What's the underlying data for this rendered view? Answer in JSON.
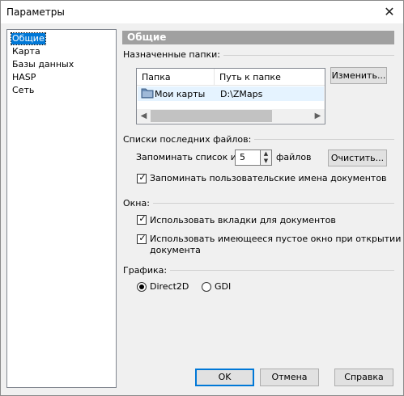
{
  "window": {
    "title": "Параметры",
    "close": "✕"
  },
  "nav": {
    "items": [
      "Общие",
      "Карта",
      "Базы данных",
      "HASP",
      "Сеть"
    ],
    "selected": 0
  },
  "section": {
    "title": "Общие"
  },
  "folders": {
    "label": "Назначенные папки:",
    "columns": [
      "Папка",
      "Путь к папке"
    ],
    "rows": [
      {
        "name": "Мои карты",
        "path": "D:\\ZMaps"
      }
    ],
    "change_button": "Изменить..."
  },
  "recent": {
    "label": "Списки последних файлов:",
    "remember_prefix": "Запоминать список из",
    "count": "5",
    "remember_suffix": "файлов",
    "clear_button": "Очистить...",
    "remember_names": {
      "label": "Запоминать пользовательские имена документов",
      "checked": true
    }
  },
  "windows": {
    "label": "Окна:",
    "use_tabs": {
      "label": "Использовать вкладки для документов",
      "checked": true
    },
    "reuse_empty_line1": "Использовать имеющееся пустое окно при открытии",
    "reuse_empty_line2": "документа",
    "reuse_empty_checked": true
  },
  "graphics": {
    "label": "Графика:",
    "options": [
      "Direct2D",
      "GDI"
    ],
    "selected": "Direct2D"
  },
  "buttons": {
    "ok": "OK",
    "cancel": "Отмена",
    "help": "Справка"
  },
  "icons": {
    "close": "close-icon",
    "folder": "folder-icon",
    "check": "✓",
    "up": "▲",
    "down": "▼",
    "left": "◀",
    "right": "▶"
  }
}
